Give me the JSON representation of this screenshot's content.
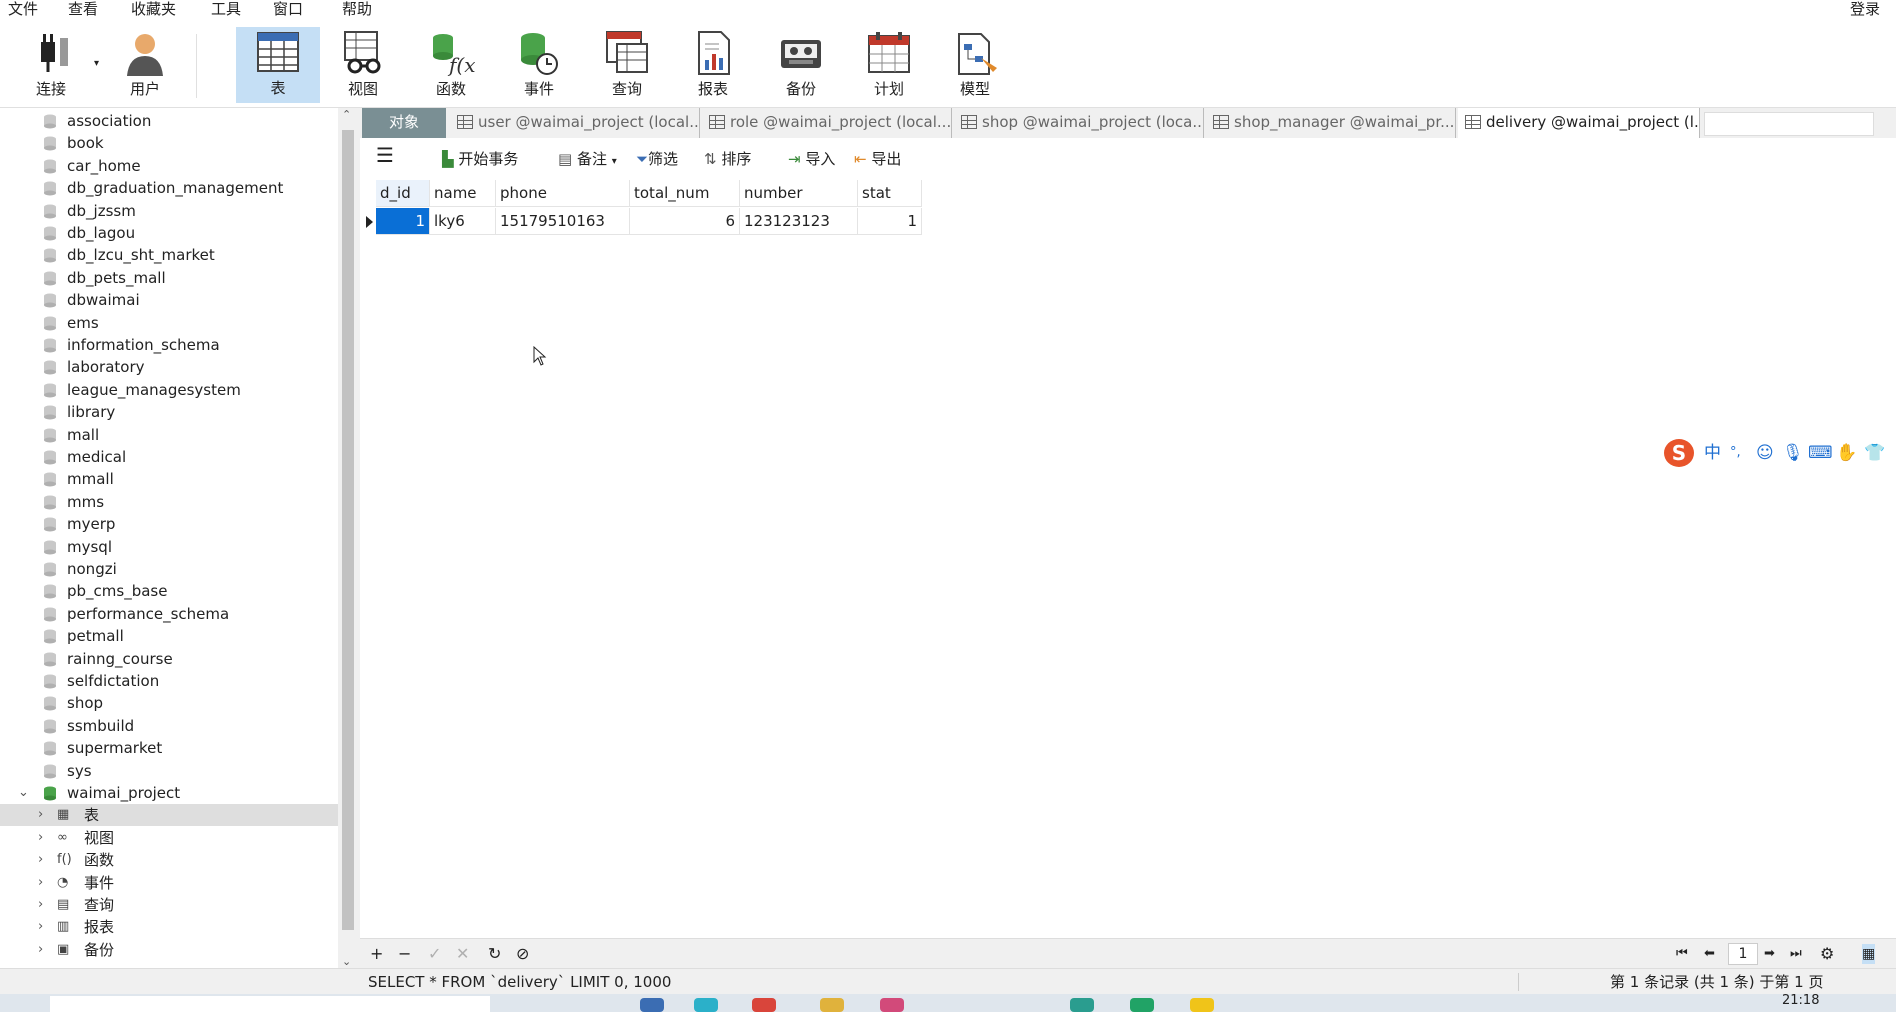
{
  "menu": {
    "file": "文件",
    "view": "查看",
    "favorites": "收藏夹",
    "tools": "工具",
    "window": "窗口",
    "help": "帮助",
    "login": "登录"
  },
  "toolbar": {
    "connect": "连接",
    "user": "用户",
    "table": "表",
    "view": "视图",
    "function": "函数",
    "event": "事件",
    "query": "查询",
    "report": "报表",
    "backup": "备份",
    "schedule": "计划",
    "model": "模型"
  },
  "sidebar": {
    "databases": [
      "association",
      "book",
      "car_home",
      "db_graduation_management",
      "db_jzssm",
      "db_lagou",
      "db_lzcu_sht_market",
      "db_pets_mall",
      "dbwaimai",
      "ems",
      "information_schema",
      "laboratory",
      "league_managesystem",
      "library",
      "mall",
      "medical",
      "mmall",
      "mms",
      "myerp",
      "mysql",
      "nongzi",
      "pb_cms_base",
      "performance_schema",
      "petmall",
      "rainng_course",
      "selfdictation",
      "shop",
      "ssmbuild",
      "supermarket",
      "sys"
    ],
    "open_db": "waimai_project",
    "children": [
      "表",
      "视图",
      "函数",
      "事件",
      "查询",
      "报表",
      "备份"
    ]
  },
  "tabs": {
    "objects": "对象",
    "items": [
      "user @waimai_project (local...",
      "role @waimai_project (local...",
      "shop @waimai_project (loca...",
      "shop_manager @waimai_pr...",
      "delivery @waimai_project (l..."
    ]
  },
  "content_toolbar": {
    "begin_tx": "开始事务",
    "note": "备注",
    "filter": "筛选",
    "sort": "排序",
    "import": "导入",
    "export": "导出"
  },
  "grid": {
    "columns": [
      "d_id",
      "name",
      "phone",
      "total_num",
      "number",
      "stat"
    ],
    "rows": [
      [
        "1",
        "lky6",
        "15179510163",
        "6",
        "123123123",
        "1"
      ]
    ]
  },
  "ime": {
    "zh": "中",
    "punct": "°,"
  },
  "pager": {
    "page": "1"
  },
  "status": {
    "sql": "SELECT * FROM `delivery` LIMIT 0, 1000",
    "records": "第 1 条记录 (共 1 条) 于第 1 页"
  },
  "taskbar": {
    "time": "21:18"
  },
  "colors": {
    "accent": "#0a6fd6",
    "active_tool": "#c5dff5",
    "tab_objects": "#7a8f94"
  }
}
